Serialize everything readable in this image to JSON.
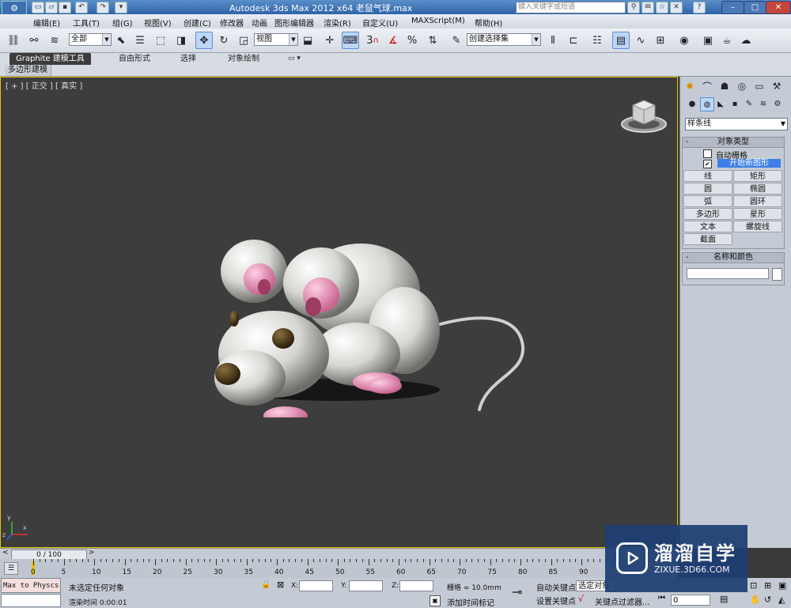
{
  "window": {
    "title": "Autodesk 3ds Max  2012 x64      老鼠气球.max",
    "search_placeholder": "键入关键字或短语",
    "controls": [
      "–",
      "□",
      "✕"
    ]
  },
  "menu": [
    "编辑(E)",
    "工具(T)",
    "组(G)",
    "视图(V)",
    "创建(C)",
    "修改器",
    "动画",
    "图形编辑器",
    "渲染(R)",
    "自定义(U)",
    "MAXScript(M)",
    "帮助(H)"
  ],
  "toolbar": {
    "selection_filter": "全部",
    "reference_coord": "视图",
    "named_selection": "创建选择集",
    "snap_labels": [
      "3",
      "%"
    ]
  },
  "ribbon": {
    "tabs": [
      "Graphite 建模工具",
      "自由形式",
      "选择",
      "对象绘制"
    ],
    "sub_label": "多边形建模"
  },
  "viewport": {
    "label": "[ + ] [ 正交 ] [ 真实 ]",
    "border_color": "#e8c400",
    "axis_labels": [
      "x",
      "y",
      "z"
    ]
  },
  "command_panel": {
    "category": "样条线",
    "object_type": {
      "header": "对象类型",
      "auto_grid": "自动栅格",
      "start_new_shape": "开始新图形",
      "buttons": [
        "线",
        "矩形",
        "圆",
        "椭圆",
        "弧",
        "圆环",
        "多边形",
        "星形",
        "文本",
        "螺旋线",
        "截面"
      ]
    },
    "name_color": {
      "header": "名称和颜色",
      "name_value": ""
    }
  },
  "timeline": {
    "slider": "0 / 100",
    "ticks": [
      "0",
      "5",
      "10",
      "15",
      "20",
      "25",
      "30",
      "35",
      "40",
      "45",
      "50",
      "55",
      "60",
      "65",
      "70",
      "75",
      "80",
      "85",
      "90"
    ]
  },
  "status": {
    "script_listener": "Max to Physcs (",
    "selection": "未选定任何对象",
    "render_time": "渲染时间  0:00:01",
    "x_label": "X:",
    "y_label": "Y:",
    "z_label": "Z:",
    "grid": "栅格 = 10.0mm",
    "add_time_tag": "添加时间标记",
    "auto_key": "自动关键点",
    "set_key": "设置关键点",
    "selected_object": "选定对象",
    "key_filters": "关键点过滤器...",
    "frame": "0"
  },
  "watermark": {
    "name": "溜溜自学",
    "url": "ZIXUE.3D66.COM"
  }
}
